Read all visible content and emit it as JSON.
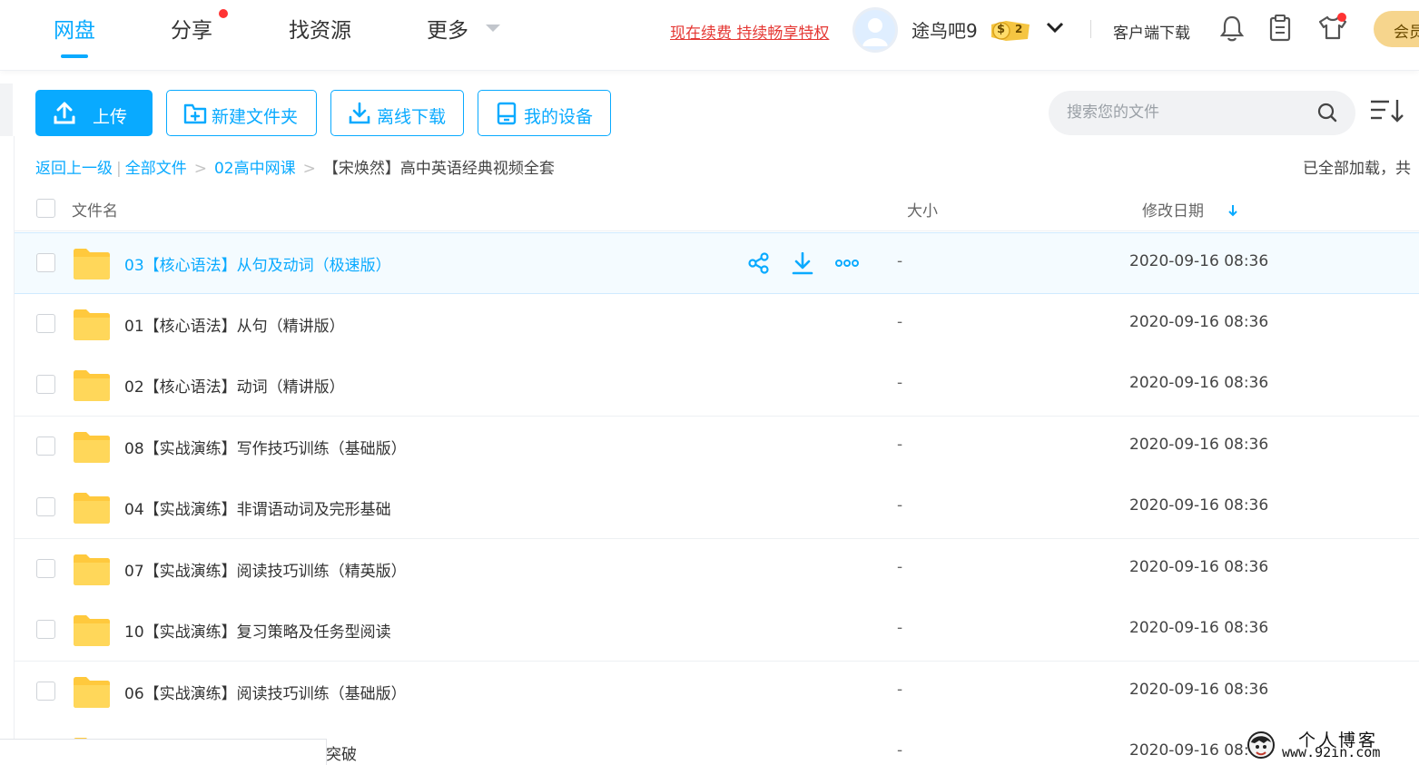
{
  "nav": {
    "tabs": [
      {
        "label": "网盘",
        "active": true
      },
      {
        "label": "分享",
        "badge": true
      },
      {
        "label": "找资源"
      },
      {
        "label": "更多"
      }
    ],
    "promo": "现在续费 持续畅享特权",
    "username": "途鸟吧9",
    "vip_level": "2",
    "vip_symbol": "$",
    "client_download": "客户端下载",
    "member_label": "会员"
  },
  "toolbar": {
    "upload": "上传",
    "new_folder": "新建文件夹",
    "offline_download": "离线下载",
    "my_devices": "我的设备",
    "search_placeholder": "搜索您的文件"
  },
  "breadcrumb": {
    "back": "返回上一级",
    "all_files": "全部文件",
    "level1": "02高中网课",
    "current": "【宋焕然】高中英语经典视频全套",
    "loaded_status": "已全部加载，共"
  },
  "table": {
    "headers": {
      "name": "文件名",
      "size": "大小",
      "modified": "修改日期"
    },
    "rows": [
      {
        "name": "03【核心语法】从句及动词（极速版）",
        "size": "-",
        "date": "2020-09-16 08:36"
      },
      {
        "name": "01【核心语法】从句（精讲版）",
        "size": "-",
        "date": "2020-09-16 08:36"
      },
      {
        "name": "02【核心语法】动词（精讲版）",
        "size": "-",
        "date": "2020-09-16 08:36"
      },
      {
        "name": "08【实战演练】写作技巧训练（基础版）",
        "size": "-",
        "date": "2020-09-16 08:36"
      },
      {
        "name": "04【实战演练】非谓语动词及完形基础",
        "size": "-",
        "date": "2020-09-16 08:36"
      },
      {
        "name": "07【实战演练】阅读技巧训练（精英版）",
        "size": "-",
        "date": "2020-09-16 08:36"
      },
      {
        "name": "10【实战演练】复习策略及任务型阅读",
        "size": "-",
        "date": "2020-09-16 08:36"
      },
      {
        "name": "06【实战演练】阅读技巧训练（基础版）",
        "size": "-",
        "date": "2020-09-16 08:36"
      },
      {
        "name": "突破",
        "size": "-",
        "date": "2020-09-16 08:"
      }
    ]
  },
  "watermark": {
    "title": "个人博客",
    "url": "www.92in.com"
  },
  "colors": {
    "accent": "#09AAFF",
    "promo": "#e53935",
    "folder": "#FFD24C",
    "member": "#f6d58d"
  }
}
